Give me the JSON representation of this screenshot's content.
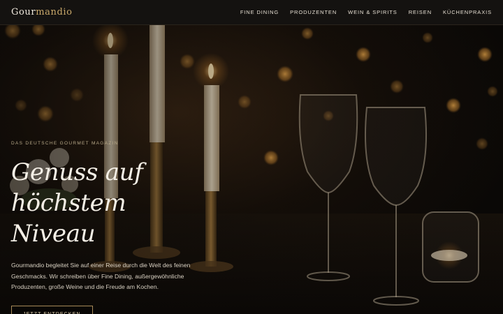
{
  "header": {
    "logo_part1": "Gour",
    "logo_part2": "mandio",
    "nav": [
      "FINE DINING",
      "PRODUZENTEN",
      "WEIN & SPIRITS",
      "REISEN",
      "KÜCHENPRAXIS"
    ]
  },
  "hero": {
    "kicker": "DAS DEUTSCHE GOURMET MAGAZIN",
    "title_line1": "Genuss auf höchstem",
    "title_line2": "Niveau",
    "description": "Gourmandio begleitet Sie auf einer Reise durch die Welt des feinen Geschmacks. Wir schreiben über Fine Dining, außergewöhnliche Produzenten, große Weine und die Freude am Kochen.",
    "cta_label": "JETZT ENTDECKEN"
  },
  "colors": {
    "background": "#0d0b09",
    "accent_gold": "#c9a86a",
    "header_bg": "#141210"
  }
}
